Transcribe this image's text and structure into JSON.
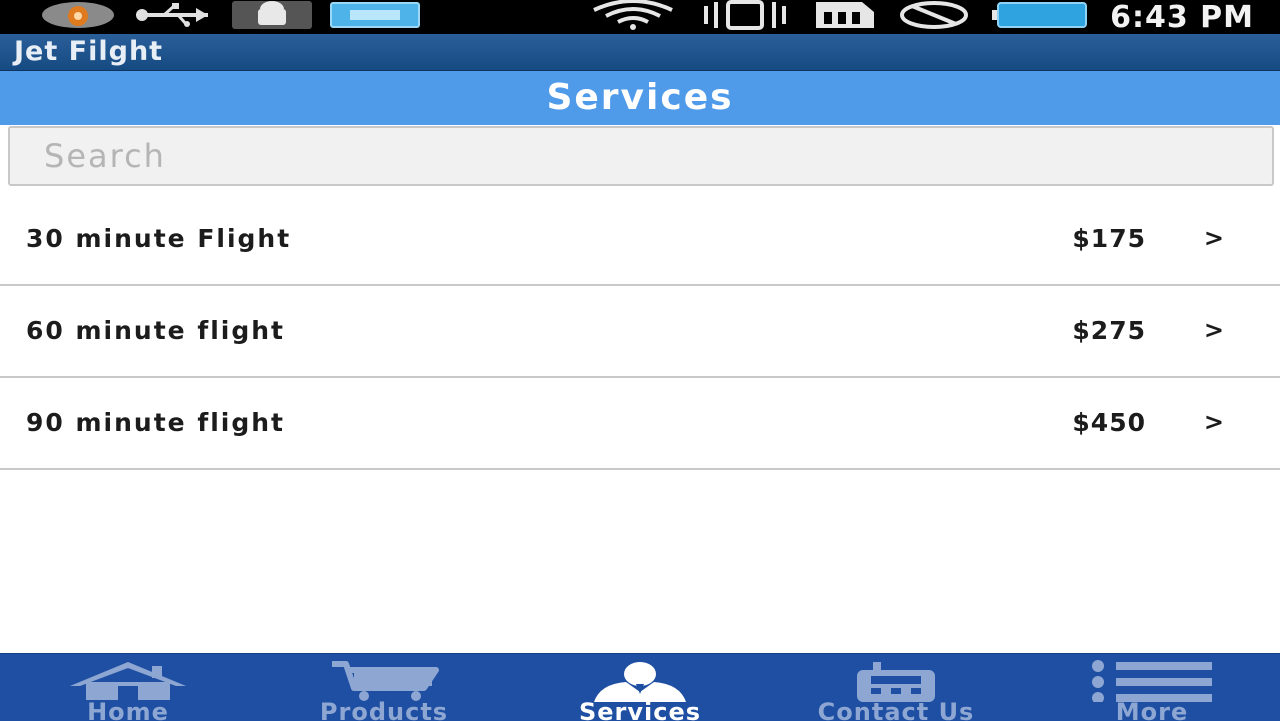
{
  "status_bar": {
    "time": "6:43 PM",
    "left_icons": [
      "notification-badge-icon",
      "usb-icon",
      "android-debug-icon",
      "keyboard-icon"
    ],
    "right_icons": [
      "wifi-icon",
      "vibrate-icon",
      "sim-icon",
      "no-signal-icon",
      "battery-icon"
    ]
  },
  "app_bar": {
    "title": "Jet Filght"
  },
  "header": {
    "title": "Services"
  },
  "search": {
    "placeholder": "Search",
    "value": ""
  },
  "services": [
    {
      "label": "30 minute Flight",
      "price": "$175",
      "chevron": ">"
    },
    {
      "label": "60 minute flight",
      "price": "$275",
      "chevron": ">"
    },
    {
      "label": "90 minute flight",
      "price": "$450",
      "chevron": ">"
    }
  ],
  "bottom_nav": {
    "items": [
      {
        "label": "Home",
        "icon": "home-icon",
        "active": false
      },
      {
        "label": "Products",
        "icon": "cart-icon",
        "active": false
      },
      {
        "label": "Services",
        "icon": "user-icon",
        "active": true
      },
      {
        "label": "Contact Us",
        "icon": "phone-icon",
        "active": false
      },
      {
        "label": "More",
        "icon": "list-icon",
        "active": false
      }
    ]
  },
  "colors": {
    "header_blue": "#4f9bea",
    "app_bar_blue": "#1e5590",
    "nav_blue": "#1f4fa3",
    "nav_inactive": "#8ea7d2"
  }
}
